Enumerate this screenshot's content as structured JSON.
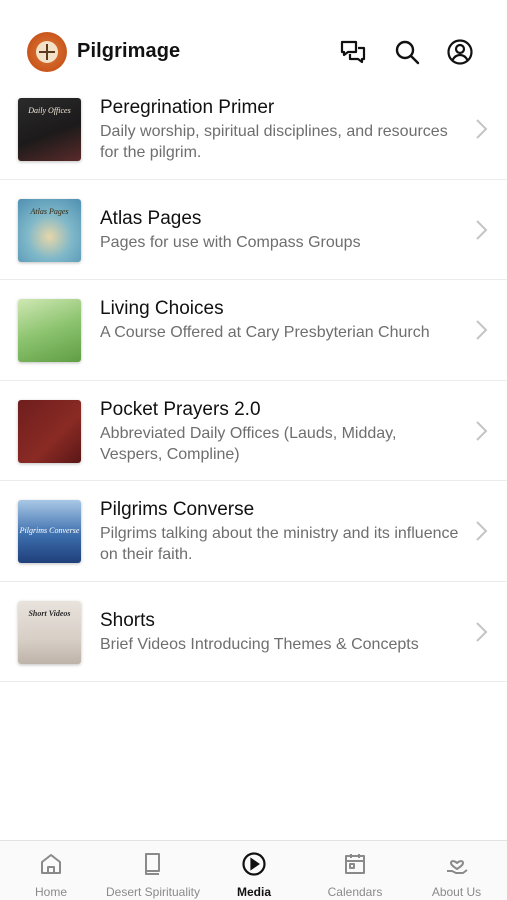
{
  "header": {
    "app_title": "Pilgrimage",
    "icons": [
      "chat-icon",
      "search-icon",
      "account-icon"
    ]
  },
  "items": [
    {
      "title": "Peregrination Primer",
      "subtitle": "Daily worship, spiritual disciplines, and resources for the pilgrim.",
      "thumb_text": "Daily Offices"
    },
    {
      "title": "Atlas Pages",
      "subtitle": "Pages for use with Compass Groups",
      "thumb_text": "Atlas Pages"
    },
    {
      "title": "Living Choices",
      "subtitle": "A Course Offered at Cary Presbyterian Church",
      "thumb_text": ""
    },
    {
      "title": "Pocket Prayers 2.0",
      "subtitle": "Abbreviated Daily Offices (Lauds, Midday, Vespers, Compline)",
      "thumb_text": ""
    },
    {
      "title": "Pilgrims Converse",
      "subtitle": "Pilgrims talking about the ministry and its influence on their faith.",
      "thumb_text": "Pilgrims Converse"
    },
    {
      "title": "Shorts",
      "subtitle": "Brief Videos Introducing Themes & Concepts",
      "thumb_text": "Short Videos"
    }
  ],
  "tabs": [
    {
      "label": "Home",
      "icon": "home-icon"
    },
    {
      "label": "Desert Spirituality",
      "icon": "book-icon"
    },
    {
      "label": "Media",
      "icon": "play-icon",
      "active": true
    },
    {
      "label": "Calendars",
      "icon": "calendar-icon"
    },
    {
      "label": "About Us",
      "icon": "heart-hand-icon"
    }
  ]
}
